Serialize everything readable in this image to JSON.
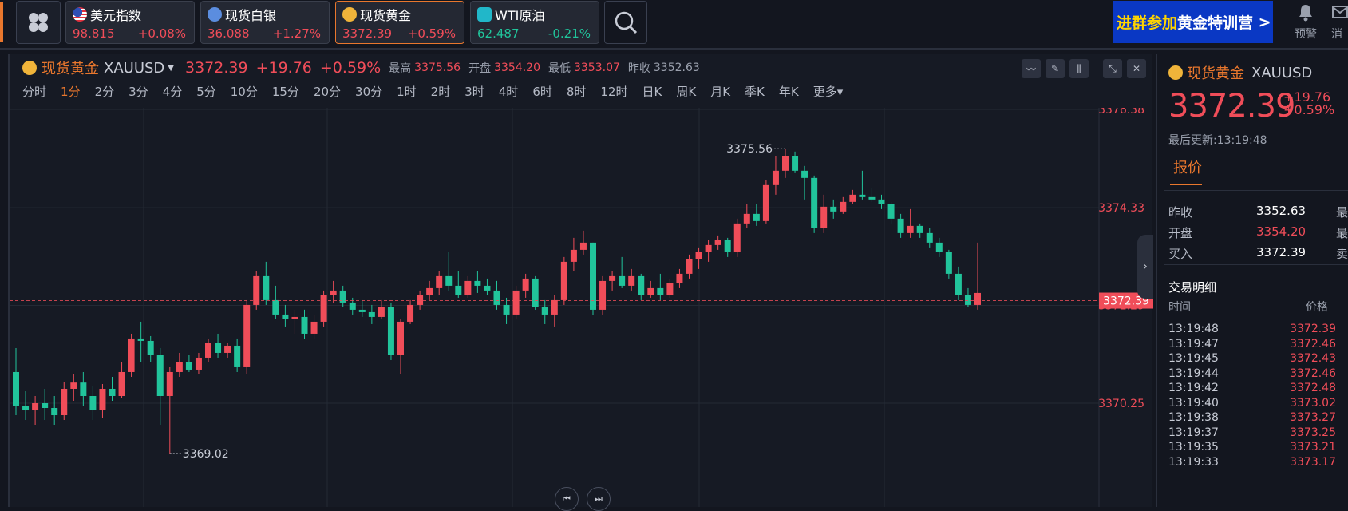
{
  "top": {
    "tickers": [
      {
        "name": "美元指数",
        "price": "98.815",
        "change": "+0.08%",
        "dir": "up",
        "icon": "us-flag-icon"
      },
      {
        "name": "现货白银",
        "price": "36.088",
        "change": "+1.27%",
        "dir": "up",
        "icon": "silver-icon"
      },
      {
        "name": "现货黄金",
        "price": "3372.39",
        "change": "+0.59%",
        "dir": "up",
        "icon": "gold-icon"
      },
      {
        "name": "WTI原油",
        "price": "62.487",
        "change": "-0.21%",
        "dir": "down",
        "icon": "oil-icon"
      }
    ],
    "banner_part1": "进群参加",
    "banner_part2": "黄金特训营",
    "banner_arrow": ">",
    "alert_label": "预警",
    "message_label": "消"
  },
  "chart_header": {
    "symbol_name": "现货黄金",
    "symbol_code": "XAUUSD",
    "price": "3372.39",
    "change": "+19.76",
    "change_pct": "+0.59%",
    "high_label": "最高",
    "high": "3375.56",
    "open_label": "开盘",
    "open": "3354.20",
    "low_label": "最低",
    "low": "3353.07",
    "prev_label": "昨收",
    "prev": "3352.63"
  },
  "periods": [
    "分时",
    "1分",
    "2分",
    "3分",
    "4分",
    "5分",
    "10分",
    "15分",
    "20分",
    "30分",
    "1时",
    "2时",
    "3时",
    "4时",
    "6时",
    "8时",
    "12时",
    "日K",
    "周K",
    "月K",
    "季K",
    "年K",
    "更多▾"
  ],
  "active_period": "1分",
  "chart_data": {
    "type": "candlestick",
    "symbol": "XAUUSD",
    "interval": "1分",
    "y_ticks": [
      "3376.38",
      "3374.33",
      "3372.29",
      "3370.25"
    ],
    "ylim": [
      3369.0,
      3376.38
    ],
    "current_price": "3372.39",
    "max_label": "3375.56",
    "min_label": "3369.02",
    "colors": {
      "up": "#f04d59",
      "down": "#21c49b"
    },
    "candles": [
      [
        3370.9,
        3371.4,
        3370.0,
        3370.2
      ],
      [
        3370.2,
        3370.5,
        3369.9,
        3370.1
      ],
      [
        3370.1,
        3370.4,
        3369.8,
        3370.25
      ],
      [
        3370.25,
        3370.55,
        3369.9,
        3370.15
      ],
      [
        3370.15,
        3370.4,
        3369.8,
        3370.0
      ],
      [
        3370.0,
        3370.7,
        3369.9,
        3370.55
      ],
      [
        3370.55,
        3370.85,
        3370.3,
        3370.68
      ],
      [
        3370.68,
        3370.9,
        3370.2,
        3370.4
      ],
      [
        3370.4,
        3370.6,
        3369.9,
        3370.1
      ],
      [
        3370.1,
        3370.65,
        3369.95,
        3370.55
      ],
      [
        3370.55,
        3370.8,
        3370.3,
        3370.4
      ],
      [
        3370.4,
        3371.1,
        3370.35,
        3370.9
      ],
      [
        3370.9,
        3371.7,
        3370.8,
        3371.6
      ],
      [
        3371.6,
        3371.95,
        3371.1,
        3371.55
      ],
      [
        3371.55,
        3371.65,
        3371.1,
        3371.25
      ],
      [
        3371.25,
        3371.4,
        3369.8,
        3370.4
      ],
      [
        3370.4,
        3371.0,
        3369.2,
        3370.9
      ],
      [
        3370.9,
        3371.3,
        3370.8,
        3371.1
      ],
      [
        3371.1,
        3371.25,
        3370.9,
        3370.95
      ],
      [
        3370.95,
        3371.3,
        3370.85,
        3371.2
      ],
      [
        3371.2,
        3371.6,
        3371.1,
        3371.5
      ],
      [
        3371.5,
        3371.7,
        3371.2,
        3371.3
      ],
      [
        3371.3,
        3371.5,
        3371.2,
        3371.45
      ],
      [
        3371.45,
        3371.6,
        3370.9,
        3371.0
      ],
      [
        3371.0,
        3372.4,
        3370.85,
        3372.3
      ],
      [
        3372.3,
        3373.0,
        3372.2,
        3372.9
      ],
      [
        3372.9,
        3373.2,
        3372.3,
        3372.4
      ],
      [
        3372.4,
        3372.7,
        3372.0,
        3372.1
      ],
      [
        3372.1,
        3372.3,
        3371.85,
        3372.0
      ],
      [
        3372.0,
        3372.2,
        3371.7,
        3372.05
      ],
      [
        3372.05,
        3372.2,
        3371.6,
        3371.7
      ],
      [
        3371.7,
        3372.1,
        3371.6,
        3371.95
      ],
      [
        3371.95,
        3372.6,
        3371.85,
        3372.5
      ],
      [
        3372.5,
        3372.8,
        3372.35,
        3372.6
      ],
      [
        3372.6,
        3372.7,
        3372.25,
        3372.35
      ],
      [
        3372.35,
        3372.45,
        3372.1,
        3372.2
      ],
      [
        3372.2,
        3372.4,
        3372.05,
        3372.15
      ],
      [
        3372.15,
        3372.3,
        3371.9,
        3372.05
      ],
      [
        3372.05,
        3372.4,
        3372.0,
        3372.25
      ],
      [
        3372.25,
        3372.35,
        3371.15,
        3371.25
      ],
      [
        3371.25,
        3372.0,
        3370.85,
        3371.95
      ],
      [
        3371.95,
        3372.4,
        3371.9,
        3372.3
      ],
      [
        3372.3,
        3372.6,
        3372.2,
        3372.5
      ],
      [
        3372.5,
        3372.8,
        3372.4,
        3372.65
      ],
      [
        3372.65,
        3373.0,
        3372.5,
        3372.9
      ],
      [
        3372.9,
        3373.4,
        3372.6,
        3372.7
      ],
      [
        3372.7,
        3373.0,
        3372.45,
        3372.5
      ],
      [
        3372.5,
        3372.9,
        3372.45,
        3372.8
      ],
      [
        3372.8,
        3373.0,
        3372.55,
        3372.7
      ],
      [
        3372.7,
        3372.85,
        3372.5,
        3372.6
      ],
      [
        3372.6,
        3372.8,
        3372.2,
        3372.3
      ],
      [
        3372.3,
        3372.45,
        3371.9,
        3372.1
      ],
      [
        3372.1,
        3372.7,
        3372.0,
        3372.6
      ],
      [
        3372.6,
        3372.95,
        3372.45,
        3372.85
      ],
      [
        3372.85,
        3372.9,
        3372.2,
        3372.25
      ],
      [
        3372.25,
        3372.4,
        3371.9,
        3372.1
      ],
      [
        3372.1,
        3372.5,
        3371.85,
        3372.4
      ],
      [
        3372.4,
        3373.3,
        3372.3,
        3373.2
      ],
      [
        3373.2,
        3373.7,
        3373.0,
        3373.45
      ],
      [
        3373.45,
        3373.85,
        3373.35,
        3373.6
      ],
      [
        3373.6,
        3373.6,
        3372.1,
        3372.2
      ],
      [
        3372.2,
        3372.9,
        3372.1,
        3372.8
      ],
      [
        3372.8,
        3373.0,
        3372.6,
        3372.9
      ],
      [
        3372.9,
        3373.3,
        3372.65,
        3372.7
      ],
      [
        3372.7,
        3373.05,
        3372.6,
        3372.9
      ],
      [
        3372.9,
        3372.95,
        3372.4,
        3372.5
      ],
      [
        3372.5,
        3372.8,
        3372.45,
        3372.65
      ],
      [
        3372.65,
        3372.95,
        3372.4,
        3372.5
      ],
      [
        3372.5,
        3372.85,
        3372.45,
        3372.75
      ],
      [
        3372.75,
        3373.05,
        3372.65,
        3372.95
      ],
      [
        3372.95,
        3373.35,
        3372.85,
        3373.25
      ],
      [
        3373.25,
        3373.5,
        3373.05,
        3373.4
      ],
      [
        3373.4,
        3373.65,
        3373.2,
        3373.55
      ],
      [
        3373.55,
        3373.75,
        3373.45,
        3373.65
      ],
      [
        3373.65,
        3373.7,
        3373.3,
        3373.4
      ],
      [
        3373.4,
        3374.1,
        3373.3,
        3374.0
      ],
      [
        3374.0,
        3374.4,
        3373.9,
        3374.2
      ],
      [
        3374.2,
        3374.4,
        3373.95,
        3374.05
      ],
      [
        3374.05,
        3374.9,
        3374.0,
        3374.8
      ],
      [
        3374.8,
        3375.4,
        3374.6,
        3375.1
      ],
      [
        3375.1,
        3375.56,
        3374.95,
        3375.4
      ],
      [
        3375.4,
        3375.5,
        3375.05,
        3375.1
      ],
      [
        3375.1,
        3375.2,
        3374.5,
        3374.95
      ],
      [
        3374.95,
        3375.0,
        3373.8,
        3373.9
      ],
      [
        3373.9,
        3374.6,
        3373.8,
        3374.35
      ],
      [
        3374.35,
        3374.5,
        3374.1,
        3374.25
      ],
      [
        3374.25,
        3374.55,
        3374.2,
        3374.45
      ],
      [
        3374.45,
        3374.7,
        3374.4,
        3374.6
      ],
      [
        3374.6,
        3375.1,
        3374.5,
        3374.55
      ],
      [
        3374.55,
        3374.75,
        3374.45,
        3374.5
      ],
      [
        3374.5,
        3374.6,
        3374.3,
        3374.4
      ],
      [
        3374.4,
        3374.45,
        3374.0,
        3374.1
      ],
      [
        3374.1,
        3374.2,
        3373.7,
        3373.8
      ],
      [
        3373.8,
        3374.3,
        3373.7,
        3373.95
      ],
      [
        3373.95,
        3374.0,
        3373.7,
        3373.8
      ],
      [
        3373.8,
        3373.9,
        3373.5,
        3373.6
      ],
      [
        3373.6,
        3373.7,
        3373.3,
        3373.4
      ],
      [
        3373.4,
        3373.45,
        3372.85,
        3372.95
      ],
      [
        3372.95,
        3373.1,
        3372.4,
        3372.5
      ],
      [
        3372.5,
        3372.65,
        3372.25,
        3372.3
      ],
      [
        3372.3,
        3373.6,
        3372.2,
        3372.55
      ]
    ]
  },
  "right_panel": {
    "symbol_name": "现货黄金",
    "symbol_code": "XAUUSD",
    "price": "3372.39",
    "change": "+19.76",
    "change_pct": "+0.59%",
    "updated": "最后更新:13:19:48",
    "tab": "报价",
    "quotes": [
      {
        "label": "昨收",
        "value": "3352.63",
        "color": "#ffffff",
        "cut": "最"
      },
      {
        "label": "开盘",
        "value": "3354.20",
        "color": "#f04d59",
        "cut": "最"
      },
      {
        "label": "买入",
        "value": "3372.39",
        "color": "#ffffff",
        "cut": "卖"
      }
    ],
    "trades_title": "交易明细",
    "col_time": "时间",
    "col_price": "价格",
    "trades": [
      {
        "t": "13:19:48",
        "p": "3372.39"
      },
      {
        "t": "13:19:47",
        "p": "3372.46"
      },
      {
        "t": "13:19:45",
        "p": "3372.43"
      },
      {
        "t": "13:19:44",
        "p": "3372.46"
      },
      {
        "t": "13:19:42",
        "p": "3372.48"
      },
      {
        "t": "13:19:40",
        "p": "3373.02"
      },
      {
        "t": "13:19:38",
        "p": "3373.27"
      },
      {
        "t": "13:19:37",
        "p": "3373.25"
      },
      {
        "t": "13:19:35",
        "p": "3373.21"
      },
      {
        "t": "13:19:33",
        "p": "3373.17"
      }
    ]
  }
}
